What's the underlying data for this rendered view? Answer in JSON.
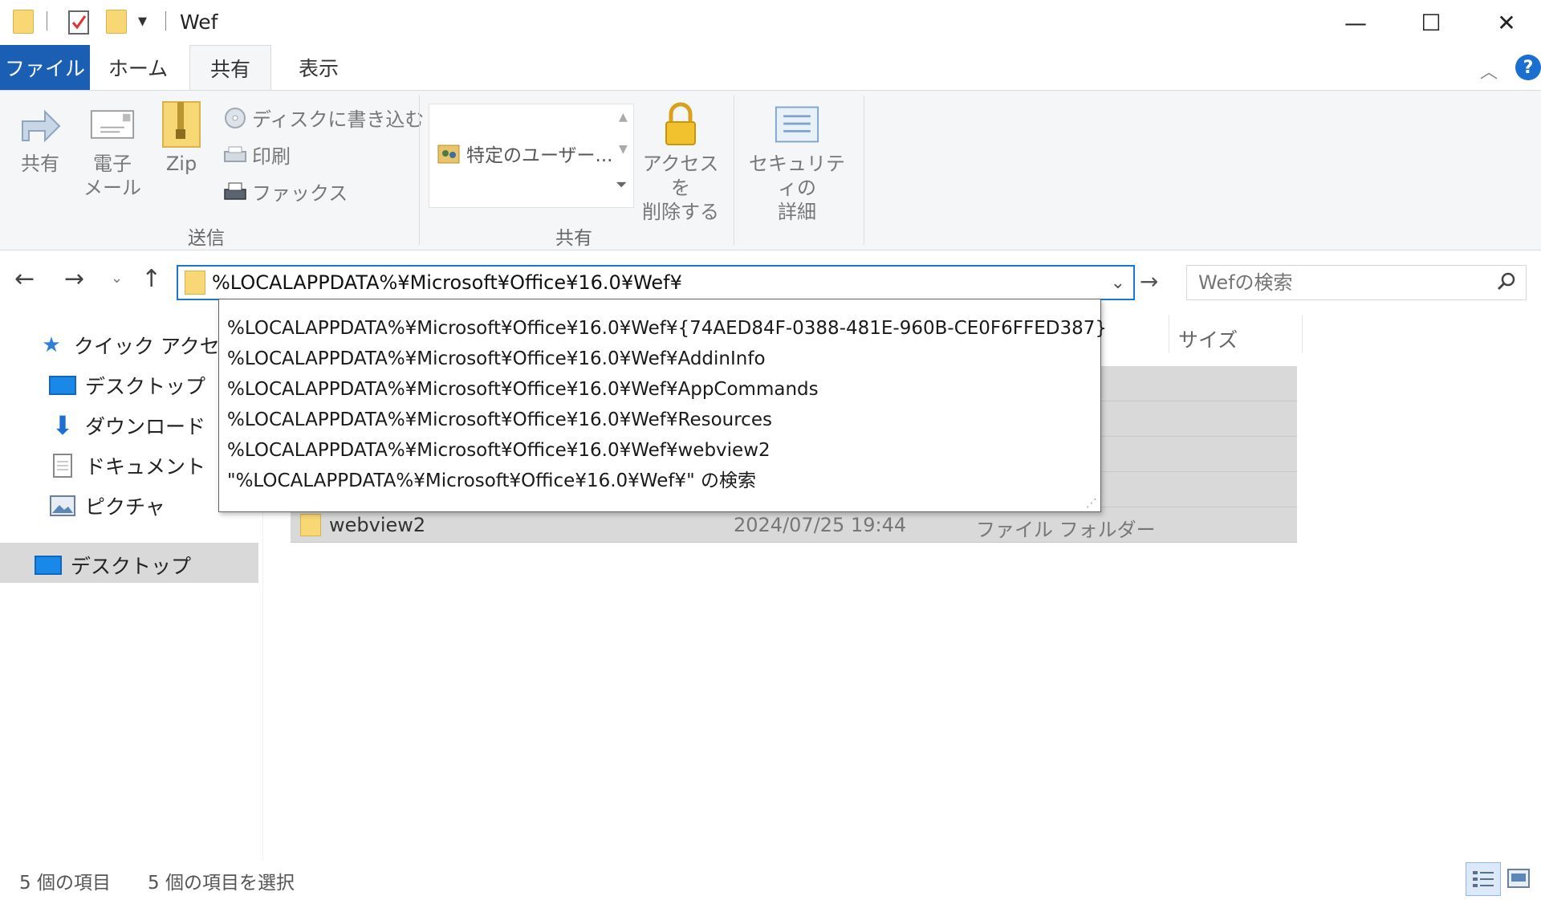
{
  "titlebar": {
    "title": "Wef",
    "minimize": "—",
    "maximize": "☐",
    "close": "✕"
  },
  "tabs": {
    "file": "ファイル",
    "home": "ホーム",
    "share": "共有",
    "view": "表示"
  },
  "ribbon": {
    "send_group": {
      "label": "送信",
      "share": "共有",
      "email_line1": "電子",
      "email_line2": "メール",
      "zip": "Zip",
      "burn": "ディスクに書き込む",
      "print": "印刷",
      "fax": "ファックス"
    },
    "share_group": {
      "label": "共有",
      "specific_users": "特定のユーザー...",
      "remove_access_line1": "アクセスを",
      "remove_access_line2": "削除する",
      "advanced_security_line1": "セキュリティの",
      "advanced_security_line2": "詳細"
    }
  },
  "address": {
    "value": "%LOCALAPPDATA%¥Microsoft¥Office¥16.0¥Wef¥"
  },
  "search": {
    "placeholder": "Wefの検索"
  },
  "autocomplete": [
    "%LOCALAPPDATA%¥Microsoft¥Office¥16.0¥Wef¥{74AED84F-0388-481E-960B-CE0F6FFED387}",
    "%LOCALAPPDATA%¥Microsoft¥Office¥16.0¥Wef¥AddinInfo",
    "%LOCALAPPDATA%¥Microsoft¥Office¥16.0¥Wef¥AppCommands",
    "%LOCALAPPDATA%¥Microsoft¥Office¥16.0¥Wef¥Resources",
    "%LOCALAPPDATA%¥Microsoft¥Office¥16.0¥Wef¥webview2",
    "\"%LOCALAPPDATA%¥Microsoft¥Office¥16.0¥Wef¥\" の検索"
  ],
  "leftnav": {
    "quick_access": "クイック アクセス",
    "desktop": "デスクトップ",
    "downloads": "ダウンロード",
    "documents": "ドキュメント",
    "pictures": "ピクチャ",
    "desktop_root": "デスクトップ"
  },
  "columns": {
    "size": "サイズ"
  },
  "visible_row": {
    "name": "webview2",
    "date": "2024/07/25 19:44",
    "type": "ファイル フォルダー"
  },
  "status": {
    "item_count": "5 個の項目",
    "selected_count": "5 個の項目を選択"
  },
  "colors": {
    "accent": "#1a5fb4",
    "address_border": "#1976d2",
    "selection_bg": "#d9d9d9",
    "ribbon_bg": "#f5f6f7"
  }
}
